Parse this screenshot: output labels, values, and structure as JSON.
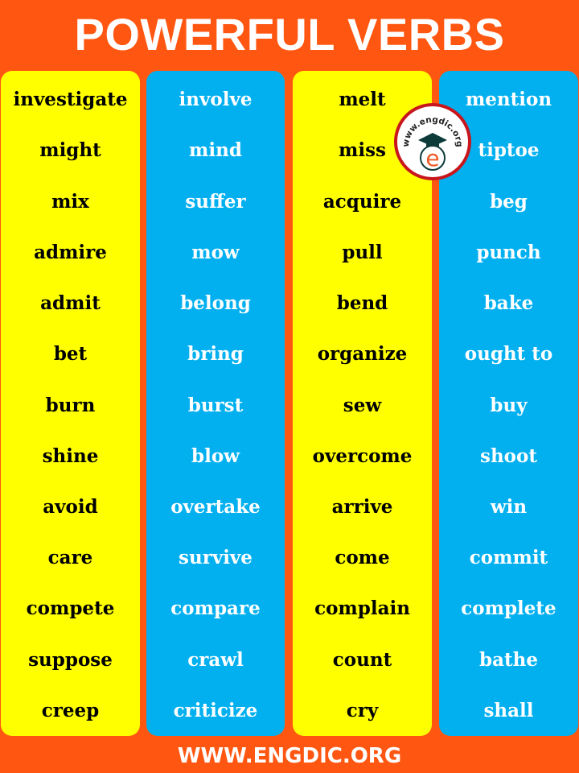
{
  "title": "POWERFUL VERBS",
  "footer": "WWW.ENGDIC.ORG",
  "logo": {
    "text": "www.engdic.org",
    "icon": "graduation-cap-icon",
    "letter": "e"
  },
  "colors": {
    "background": "#ff5711",
    "yellow": "#ffff00",
    "blue": "#02b0f0",
    "logo_ring": "#c8161d"
  },
  "columns": [
    {
      "color": "yellow",
      "words": [
        "investigate",
        "might",
        "mix",
        "admire",
        "admit",
        "bet",
        "burn",
        "shine",
        "avoid",
        "care",
        "compete",
        "suppose",
        "creep"
      ]
    },
    {
      "color": "blue",
      "words": [
        "involve",
        "mind",
        "suffer",
        "mow",
        "belong",
        "bring",
        "burst",
        "blow",
        "overtake",
        "survive",
        "compare",
        "crawl",
        "criticize"
      ]
    },
    {
      "color": "yellow",
      "words": [
        "melt",
        "miss",
        "acquire",
        "pull",
        "bend",
        "organize",
        "sew",
        "overcome",
        "arrive",
        "come",
        "complain",
        "count",
        "cry"
      ]
    },
    {
      "color": "blue",
      "words": [
        "mention",
        "tiptoe",
        "beg",
        "punch",
        "bake",
        "ought to",
        "buy",
        "shoot",
        "win",
        "commit",
        "complete",
        "bathe",
        "shall"
      ]
    }
  ]
}
